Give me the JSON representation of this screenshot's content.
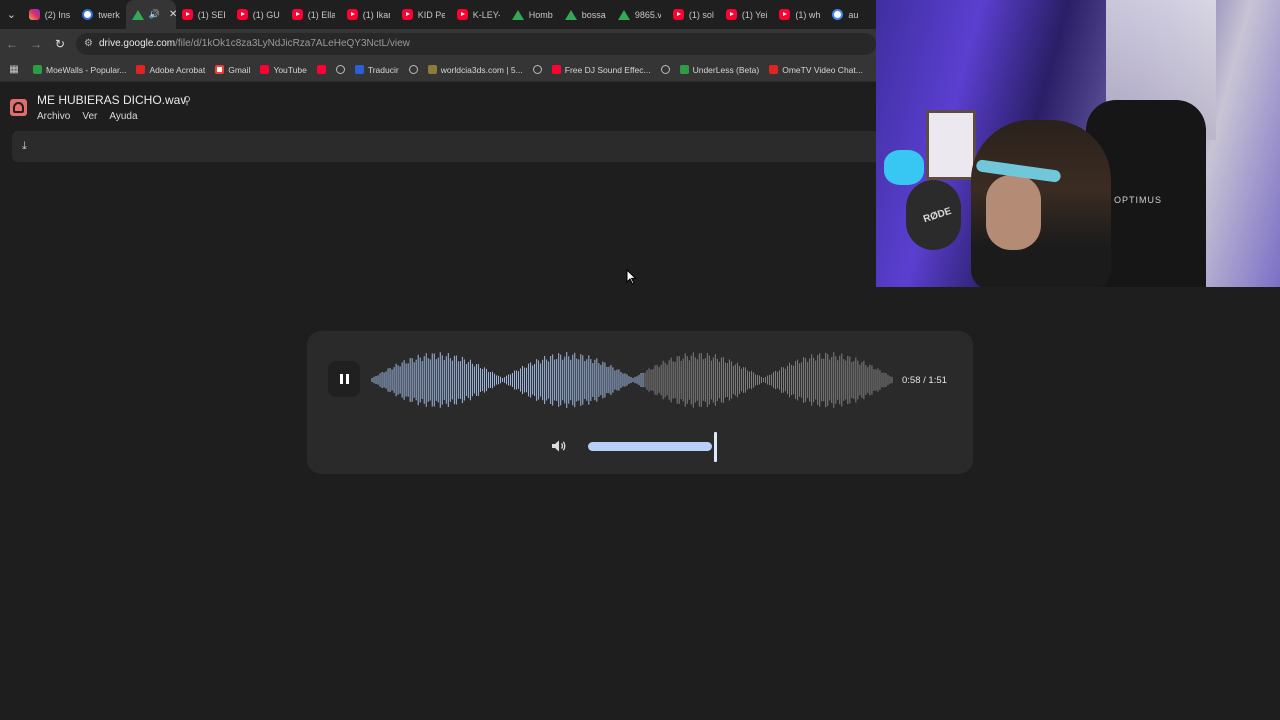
{
  "browser": {
    "tabs": [
      {
        "label": "(2) Ins",
        "icon": "instagram-icon"
      },
      {
        "label": "twerk",
        "icon": "clock-icon"
      },
      {
        "label": "",
        "icon": "drive-icon",
        "active": true
      },
      {
        "label": "(1) SEF",
        "icon": "youtube-icon"
      },
      {
        "label": "(1) GU",
        "icon": "youtube-icon"
      },
      {
        "label": "(1) Ella",
        "icon": "youtube-icon"
      },
      {
        "label": "(1) Ikar",
        "icon": "youtube-icon"
      },
      {
        "label": "KID Pe",
        "icon": "youtube-icon"
      },
      {
        "label": "K-LEY-",
        "icon": "youtube-icon"
      },
      {
        "label": "Homb",
        "icon": "drive-icon"
      },
      {
        "label": "bossa",
        "icon": "drive-icon"
      },
      {
        "label": "9865.v",
        "icon": "drive-icon"
      },
      {
        "label": "(1) sol",
        "icon": "youtube-icon"
      },
      {
        "label": "(1) Yei",
        "icon": "youtube-icon"
      },
      {
        "label": "(1) wh",
        "icon": "youtube-icon"
      },
      {
        "label": "au",
        "icon": "google-icon"
      }
    ],
    "url_host": "drive.google.com",
    "url_path": "/file/d/1kOk1c8za3LyNdJicRza7ALeHeQY3NctL/view",
    "bookmarks": [
      {
        "label": "MoeWalls - Popular...",
        "icon": "green"
      },
      {
        "label": "Adobe Acrobat",
        "icon": "red"
      },
      {
        "label": "Gmail",
        "icon": "gmail"
      },
      {
        "label": "YouTube",
        "icon": "yt"
      },
      {
        "label": "",
        "icon": "yt"
      },
      {
        "label": "",
        "icon": "globe"
      },
      {
        "label": "Traducir",
        "icon": "blue"
      },
      {
        "label": "",
        "icon": "globe"
      },
      {
        "label": "worldcia3ds.com | 5...",
        "icon": "img"
      },
      {
        "label": "",
        "icon": "globe"
      },
      {
        "label": "Free DJ Sound Effec...",
        "icon": "yt"
      },
      {
        "label": "",
        "icon": "globe"
      },
      {
        "label": "UnderLess (Beta)",
        "icon": "green"
      },
      {
        "label": "OmeTV Video Chat...",
        "icon": "red"
      }
    ]
  },
  "drive": {
    "file_name": "ME HUBIERAS DICHO.wav",
    "menu": [
      "Archivo",
      "Ver",
      "Ayuda"
    ]
  },
  "webcam": {
    "mic_brand": "RØDE",
    "chair_brand": "OPTIMUS"
  },
  "player": {
    "time": "0:58 / 1:51",
    "progress_fraction": 0.52,
    "volume_fraction": 1.0,
    "played_color": "#a9c7f5",
    "unplayed_color": "#8a8a8a",
    "accent_color": "#b8d0f7"
  }
}
